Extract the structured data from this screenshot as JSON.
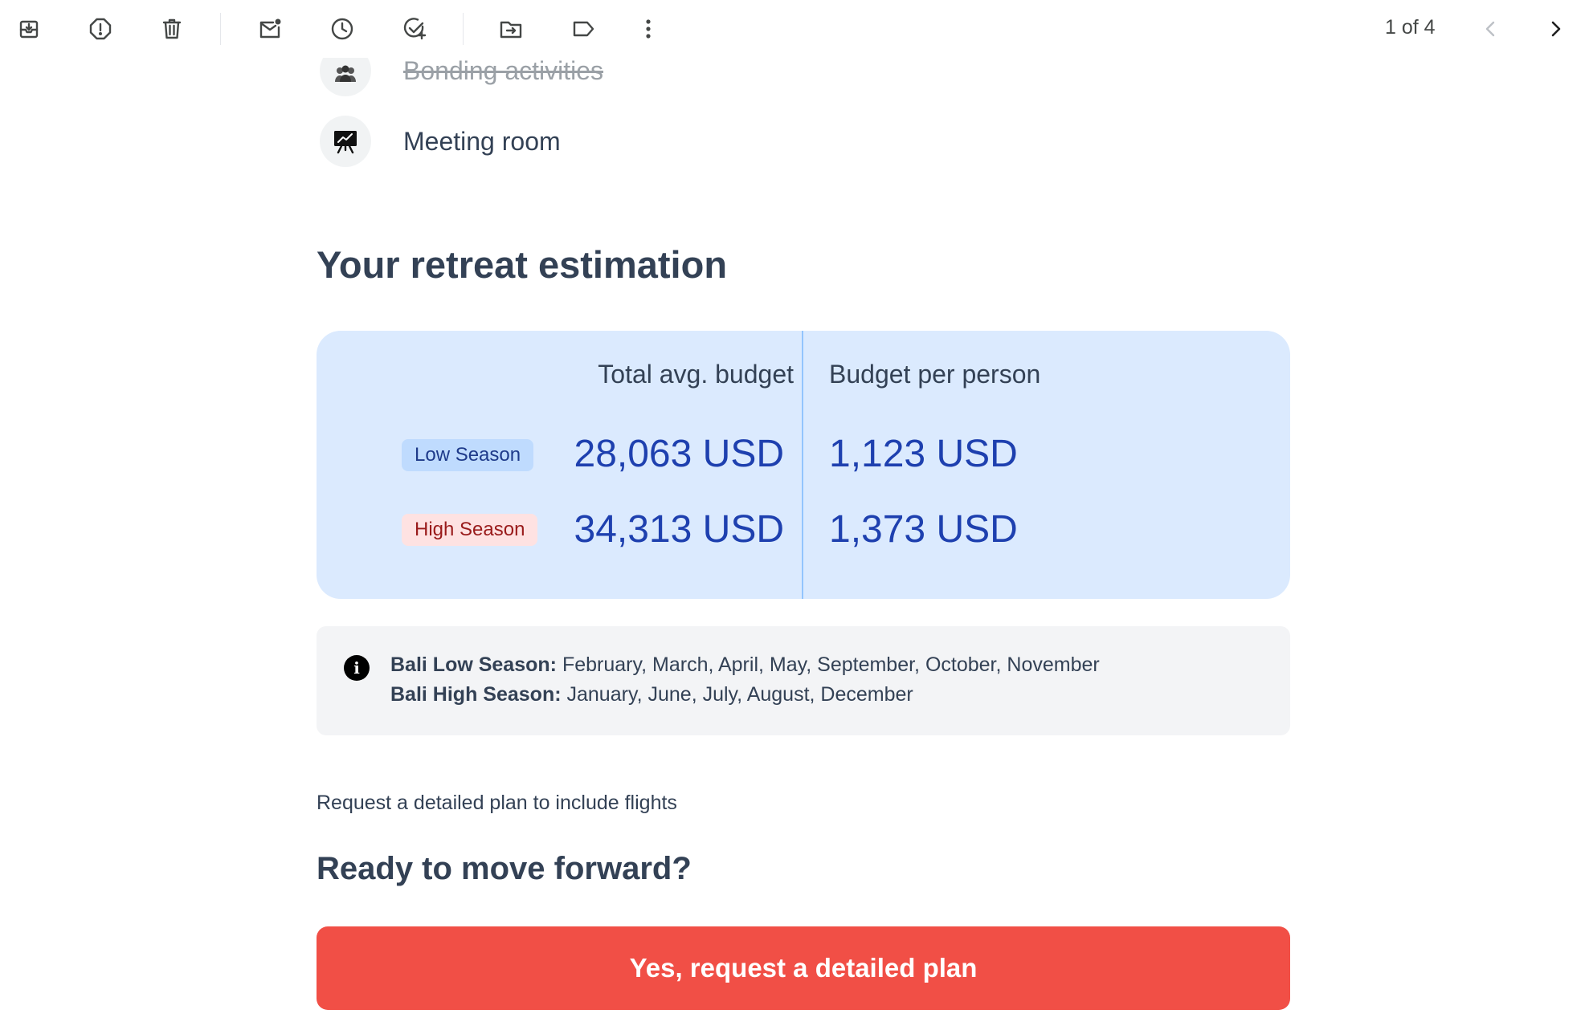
{
  "toolbar": {
    "icons": [
      "archive-icon",
      "report-spam-icon",
      "delete-icon",
      "mark-unread-icon",
      "snooze-icon",
      "add-task-icon",
      "move-to-icon",
      "label-icon",
      "more-icon"
    ],
    "pager_text": "1 of 4",
    "prev_icon": "chevron-left-icon",
    "next_icon": "chevron-right-icon"
  },
  "activities": [
    {
      "label": "Bonding activities",
      "struck": true
    },
    {
      "label": "Meeting room",
      "struck": false
    }
  ],
  "estimation": {
    "title": "Your retreat estimation",
    "total_header": "Total avg. budget",
    "per_person_header": "Budget per person",
    "rows": [
      {
        "season": "Low Season",
        "total": "28,063 USD",
        "per_person": "1,123 USD"
      },
      {
        "season": "High Season",
        "total": "34,313 USD",
        "per_person": "1,373 USD"
      }
    ]
  },
  "info": {
    "low_label": "Bali Low Season:",
    "low_months": "February, March, April, May, September, October, November",
    "high_label": "Bali High Season:",
    "high_months": "January, June, July, August, December"
  },
  "note": "Request a detailed plan to include flights",
  "cta": {
    "heading": "Ready to move forward?",
    "button_label": "Yes, request a detailed plan"
  },
  "colors": {
    "card_bg": "#dbeafe",
    "amount": "#1e40af",
    "low_badge_bg": "#bfdbfe",
    "high_badge_bg": "#fee2e2",
    "high_badge_text": "#991b1b",
    "cta_bg": "#f14f46"
  }
}
